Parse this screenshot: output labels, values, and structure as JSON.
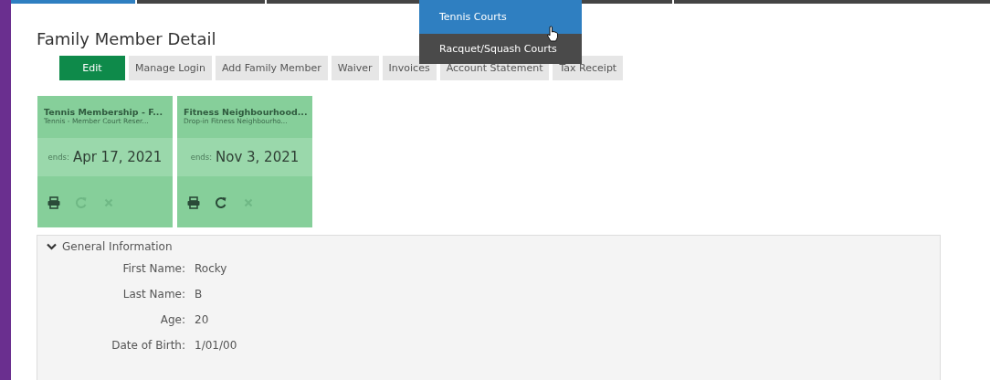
{
  "nav_tabs": [
    {
      "selected": true
    },
    {
      "selected": false
    },
    {
      "selected": false
    },
    {
      "selected": false
    },
    {
      "selected": false
    }
  ],
  "dropdown": {
    "items": [
      {
        "label": "Tennis Courts",
        "selected": true
      },
      {
        "label": "Racquet/Squash Courts",
        "selected": false
      }
    ]
  },
  "page_title": "Family Member Detail",
  "buttons": [
    {
      "label": "Edit",
      "kind": "primary"
    },
    {
      "label": "Manage Login",
      "kind": "default"
    },
    {
      "label": "Add Family Member",
      "kind": "default"
    },
    {
      "label": "Waiver",
      "kind": "default"
    },
    {
      "label": "Invoices",
      "kind": "default"
    },
    {
      "label": "Account Statement",
      "kind": "default"
    },
    {
      "label": "Tax Receipt",
      "kind": "default"
    }
  ],
  "memberships": [
    {
      "title": "Tennis Membership - F...",
      "subtitle": "Tennis - Member Court Reser...",
      "ends_label": "ends:",
      "ends_date": "Apr 17, 2021",
      "print_disabled": false,
      "renew_disabled": true,
      "cancel_disabled": true
    },
    {
      "title": "Fitness Neighbourhood...",
      "subtitle": "Drop-in Fitness Neighbourho...",
      "ends_label": "ends:",
      "ends_date": "Nov 3, 2021",
      "print_disabled": false,
      "renew_disabled": false,
      "cancel_disabled": true
    }
  ],
  "general_information": {
    "title": "General Information",
    "expanded": true,
    "fields": [
      {
        "label": "First Name:",
        "value": "Rocky"
      },
      {
        "label": "Last Name:",
        "value": "B"
      },
      {
        "label": "Age:",
        "value": "20"
      },
      {
        "label": "Date of Birth:",
        "value": "1/01/00"
      }
    ]
  }
}
